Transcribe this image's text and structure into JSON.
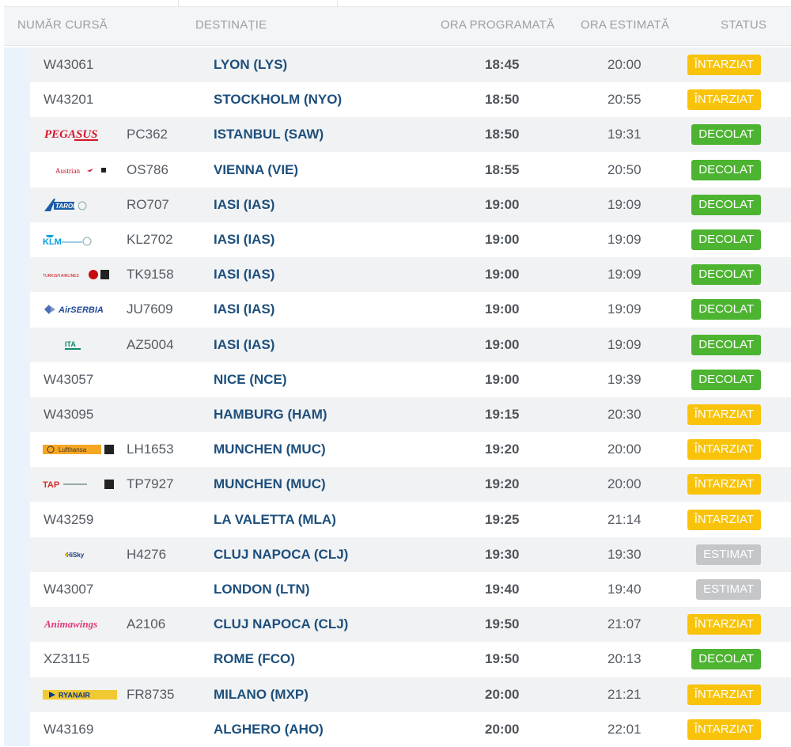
{
  "header": {
    "flight_number": "NUMĂR CURSĂ",
    "destination": "DESTINAȚIE",
    "scheduled": "ORA PROGRAMATĂ",
    "estimated": "ORA ESTIMATĂ",
    "status": "STATUS"
  },
  "colors": {
    "delayed": "#f8c30a",
    "departed": "#4cb430",
    "estimated": "#c4c6c8",
    "destination_text": "#1d4f7c"
  },
  "flights": [
    {
      "airline_logo": "",
      "flight": "W43061",
      "destination": "LYON (LYS)",
      "scheduled": "18:45",
      "estimated": "20:00",
      "status": "ÎNTARZIAT",
      "status_type": "delayed"
    },
    {
      "airline_logo": "",
      "flight": "W43201",
      "destination": "STOCKHOLM (NYO)",
      "scheduled": "18:50",
      "estimated": "20:55",
      "status": "ÎNTARZIAT",
      "status_type": "delayed"
    },
    {
      "airline_logo": "pegasus-logo",
      "logo_text": "PEGASUS",
      "flight": "PC362",
      "destination": "ISTANBUL (SAW)",
      "scheduled": "18:50",
      "estimated": "19:31",
      "status": "DECOLAT",
      "status_type": "departed"
    },
    {
      "airline_logo": "austrian-logo",
      "logo_text": "Austrian",
      "flight": "OS786",
      "destination": "VIENNA (VIE)",
      "scheduled": "18:55",
      "estimated": "20:50",
      "status": "DECOLAT",
      "status_type": "departed"
    },
    {
      "airline_logo": "tarom-logo",
      "logo_text": "TAROM",
      "flight": "RO707",
      "destination": "IASI (IAS)",
      "scheduled": "19:00",
      "estimated": "19:09",
      "status": "DECOLAT",
      "status_type": "departed"
    },
    {
      "airline_logo": "klm-logo",
      "logo_text": "KLM",
      "flight": "KL2702",
      "destination": "IASI (IAS)",
      "scheduled": "19:00",
      "estimated": "19:09",
      "status": "DECOLAT",
      "status_type": "departed"
    },
    {
      "airline_logo": "turkish-airlines-logo",
      "logo_text": "TURKISH AIRLINES",
      "flight": "TK9158",
      "destination": "IASI (IAS)",
      "scheduled": "19:00",
      "estimated": "19:09",
      "status": "DECOLAT",
      "status_type": "departed"
    },
    {
      "airline_logo": "airserbia-logo",
      "logo_text": "AirSERBIA",
      "flight": "JU7609",
      "destination": "IASI (IAS)",
      "scheduled": "19:00",
      "estimated": "19:09",
      "status": "DECOLAT",
      "status_type": "departed"
    },
    {
      "airline_logo": "ita-logo",
      "logo_text": "ITA",
      "flight": "AZ5004",
      "destination": "IASI (IAS)",
      "scheduled": "19:00",
      "estimated": "19:09",
      "status": "DECOLAT",
      "status_type": "departed"
    },
    {
      "airline_logo": "",
      "flight": "W43057",
      "destination": "NICE (NCE)",
      "scheduled": "19:00",
      "estimated": "19:39",
      "status": "DECOLAT",
      "status_type": "departed"
    },
    {
      "airline_logo": "",
      "flight": "W43095",
      "destination": "HAMBURG (HAM)",
      "scheduled": "19:15",
      "estimated": "20:30",
      "status": "ÎNTARZIAT",
      "status_type": "delayed"
    },
    {
      "airline_logo": "lufthansa-logo",
      "logo_text": "Lufthansa",
      "flight": "LH1653",
      "destination": "MUNCHEN (MUC)",
      "scheduled": "19:20",
      "estimated": "20:00",
      "status": "ÎNTARZIAT",
      "status_type": "delayed"
    },
    {
      "airline_logo": "tap-portugal-logo",
      "logo_text": "TAP",
      "flight": "TP7927",
      "destination": "MUNCHEN (MUC)",
      "scheduled": "19:20",
      "estimated": "20:00",
      "status": "ÎNTARZIAT",
      "status_type": "delayed"
    },
    {
      "airline_logo": "",
      "flight": "W43259",
      "destination": "LA VALETTA (MLA)",
      "scheduled": "19:25",
      "estimated": "21:14",
      "status": "ÎNTARZIAT",
      "status_type": "delayed"
    },
    {
      "airline_logo": "hisky-logo",
      "logo_text": "HiSky",
      "flight": "H4276",
      "destination": "CLUJ NAPOCA (CLJ)",
      "scheduled": "19:30",
      "estimated": "19:30",
      "status": "ESTIMAT",
      "status_type": "estimated"
    },
    {
      "airline_logo": "",
      "flight": "W43007",
      "destination": "LONDON (LTN)",
      "scheduled": "19:40",
      "estimated": "19:40",
      "status": "ESTIMAT",
      "status_type": "estimated"
    },
    {
      "airline_logo": "animawings-logo",
      "logo_text": "Animawings",
      "flight": "A2106",
      "destination": "CLUJ NAPOCA (CLJ)",
      "scheduled": "19:50",
      "estimated": "21:07",
      "status": "ÎNTARZIAT",
      "status_type": "delayed"
    },
    {
      "airline_logo": "",
      "flight": "XZ3115",
      "destination": "ROME (FCO)",
      "scheduled": "19:50",
      "estimated": "20:13",
      "status": "DECOLAT",
      "status_type": "departed"
    },
    {
      "airline_logo": "ryanair-logo",
      "logo_text": "RYANAIR",
      "flight": "FR8735",
      "destination": "MILANO (MXP)",
      "scheduled": "20:00",
      "estimated": "21:21",
      "status": "ÎNTARZIAT",
      "status_type": "delayed"
    },
    {
      "airline_logo": "",
      "flight": "W43169",
      "destination": "ALGHERO (AHO)",
      "scheduled": "20:00",
      "estimated": "22:01",
      "status": "ÎNTARZIAT",
      "status_type": "delayed"
    }
  ]
}
